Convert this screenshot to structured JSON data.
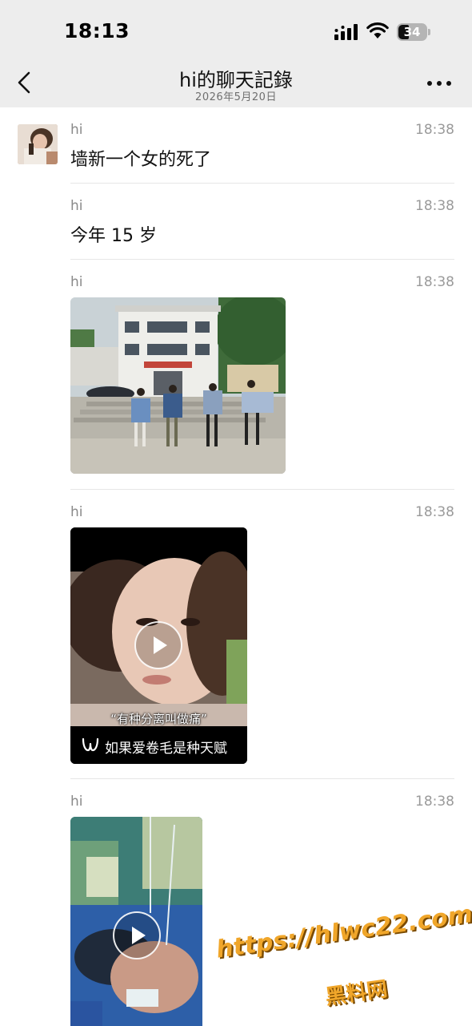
{
  "status_bar": {
    "time": "18:13",
    "battery_level": "34",
    "icons": [
      "cellular-signal-icon",
      "wifi-icon",
      "battery-icon"
    ]
  },
  "header": {
    "title": "hi的聊天記錄",
    "subtitle": "2026年5月20日",
    "back_icon": "chevron-left-icon",
    "more_icon": "ellipsis-icon"
  },
  "messages": [
    {
      "sender": "hi",
      "time": "18:38",
      "type": "text",
      "text": "墙新一个女的死了"
    },
    {
      "sender": "hi",
      "time": "18:38",
      "type": "text",
      "text": "今年 15 岁"
    },
    {
      "sender": "hi",
      "time": "18:38",
      "type": "image"
    },
    {
      "sender": "hi",
      "time": "18:38",
      "type": "video",
      "caption": "“有种分离叫做痛”",
      "channel": "如果爱卷毛是种天赋"
    },
    {
      "sender": "hi",
      "time": "18:38",
      "type": "video"
    }
  ],
  "watermark": {
    "url": "https://hlwc22.com",
    "name": "黑料网"
  },
  "colors": {
    "header_bg": "#ededed",
    "meta_text": "#9a9a9a",
    "watermark": "#f0a62a"
  }
}
